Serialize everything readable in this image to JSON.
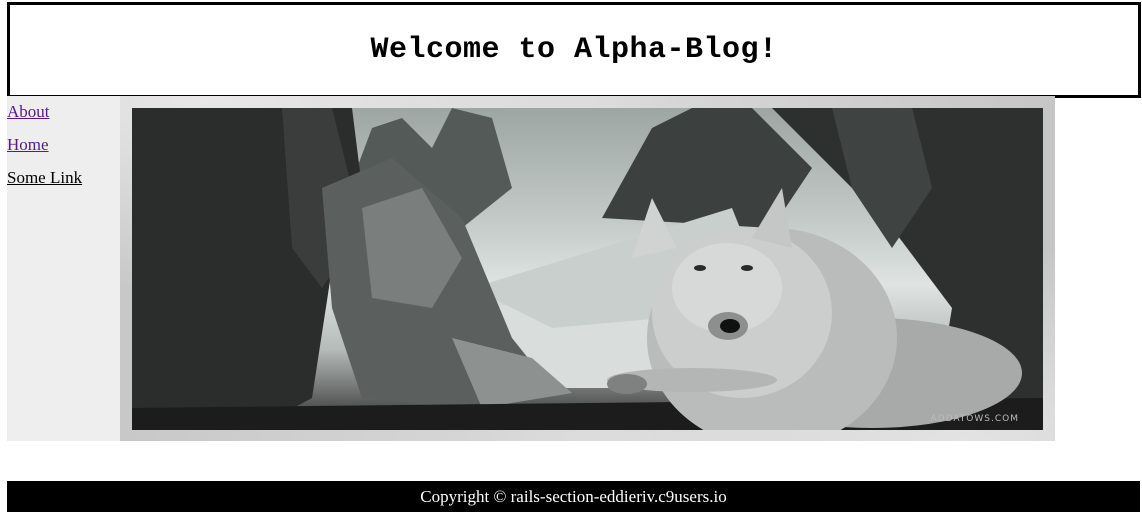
{
  "header": {
    "title": "Welcome to Alpha-Blog!"
  },
  "sidebar": {
    "links": [
      {
        "label": "About"
      },
      {
        "label": "Home"
      },
      {
        "label": "Some Link"
      }
    ]
  },
  "hero": {
    "image": "wolf-lying-among-rocky-mountains-photo",
    "watermark": "ADDATOWS.COM"
  },
  "footer": {
    "copyright": "Copyright © rails-section-eddieriv.c9users.io"
  }
}
